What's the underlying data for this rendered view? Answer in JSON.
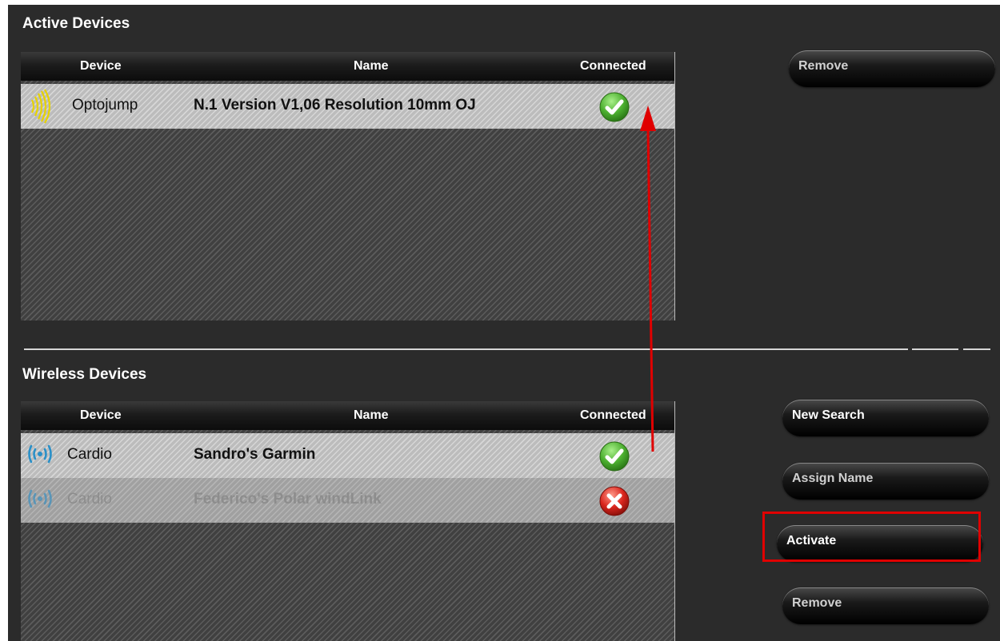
{
  "active_devices": {
    "title": "Active Devices",
    "columns": [
      "Device",
      "Name",
      "Connected"
    ],
    "rows": [
      {
        "device": "Optojump",
        "name": "N.1 Version V1,06 Resolution 10mm OJ",
        "connected": true,
        "icon": "optojump-icon",
        "dimmed": false
      }
    ],
    "buttons": {
      "remove": "Remove"
    }
  },
  "wireless_devices": {
    "title": "Wireless Devices",
    "columns": [
      "Device",
      "Name",
      "Connected"
    ],
    "rows": [
      {
        "device": "Cardio",
        "name": "Sandro's Garmin",
        "connected": true,
        "icon": "wireless-signal-icon",
        "dimmed": false
      },
      {
        "device": "Cardio",
        "name": "Federico's Polar windLink",
        "connected": false,
        "icon": "wireless-signal-icon",
        "dimmed": true
      }
    ],
    "buttons": {
      "new_search": "New Search",
      "assign_name": "Assign Name",
      "activate": "Activate",
      "remove": "Remove"
    }
  },
  "annotations": {
    "highlighted_button": "Activate",
    "arrow_color": "#e00000"
  },
  "colors": {
    "background": "#2b2b2b",
    "connected": "#4caf30",
    "disconnected": "#d9251d",
    "optojump_icon": "#e6d200",
    "wireless_icon": "#2a90c8"
  }
}
